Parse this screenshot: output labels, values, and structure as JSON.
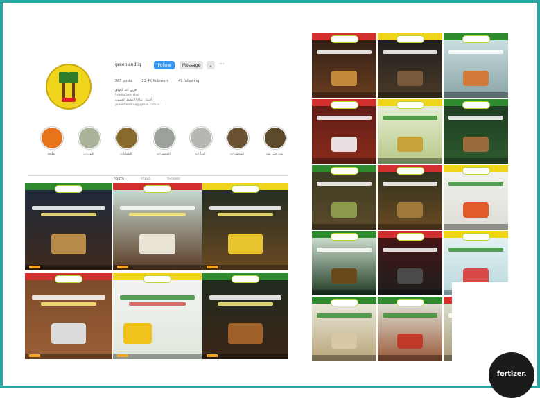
{
  "profile": {
    "username": "greenland.iq",
    "follow_label": "Follow",
    "message_label": "Message",
    "stats": [
      "965 posts",
      "23.4K followers",
      "49 following"
    ],
    "bio": [
      "جرين لاند العراق",
      "Product/service",
      "أفضل أنواع الأطعمة العضوية",
      "greenlandiraq@gmail.com + 1"
    ]
  },
  "highlights": [
    {
      "label": "بطاقة",
      "color": "#e8731b"
    },
    {
      "label": "البهارات",
      "color": "#a8b39a"
    },
    {
      "label": "البقوليات",
      "color": "#8a6a2c"
    },
    {
      "label": "المكسرات",
      "color": "#9aa29a"
    },
    {
      "label": "البهارات",
      "color": "#b7b7b2"
    },
    {
      "label": "المكسرات",
      "color": "#6b5331"
    },
    {
      "label": "بيت خلي بيت",
      "color": "#5d4a2a"
    }
  ],
  "tabs": [
    "POSTS",
    "REELS",
    "TAGGED"
  ],
  "brand": {
    "name": "fertizer.",
    "accent": "#2aa7a2",
    "yellow": "#f1d41c",
    "green": "#2e8b2e",
    "red": "#d32f2f"
  }
}
